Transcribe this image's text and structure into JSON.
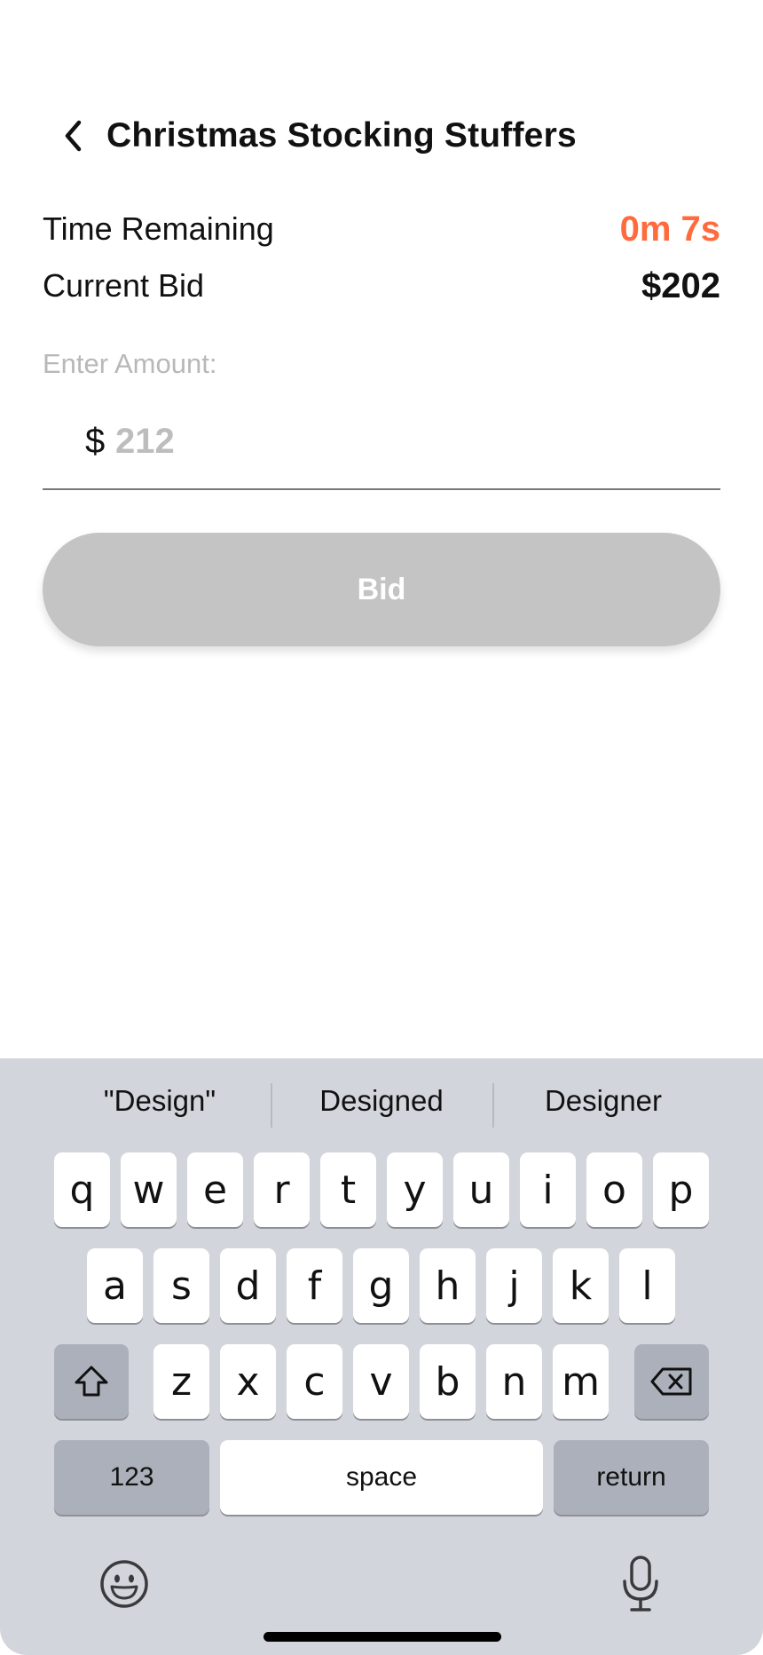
{
  "header": {
    "title": "Christmas Stocking Stuffers",
    "back_icon": "chevron-left-icon"
  },
  "auction": {
    "time_label": "Time Remaining",
    "time_value": "0m 7s",
    "bid_label": "Current Bid",
    "bid_value": "$202"
  },
  "amount": {
    "label": "Enter Amount:",
    "currency": "$",
    "placeholder": "212",
    "value": ""
  },
  "bid_button": {
    "label": "Bid"
  },
  "colors": {
    "accent_time": "#FF6B3D",
    "button_disabled": "#C4C4C4",
    "keyboard_bg": "#D2D5DB"
  },
  "keyboard": {
    "suggestions": [
      "\"Design\"",
      "Designed",
      "Designer"
    ],
    "row1": [
      "q",
      "w",
      "e",
      "r",
      "t",
      "y",
      "u",
      "i",
      "o",
      "p"
    ],
    "row2": [
      "a",
      "s",
      "d",
      "f",
      "g",
      "h",
      "j",
      "k",
      "l"
    ],
    "row3": [
      "z",
      "x",
      "c",
      "v",
      "b",
      "n",
      "m"
    ],
    "numbers_label": "123",
    "space_label": "space",
    "return_label": "return",
    "icons": {
      "shift": "shift-icon",
      "backspace": "backspace-icon",
      "emoji": "emoji-icon",
      "mic": "microphone-icon"
    }
  }
}
